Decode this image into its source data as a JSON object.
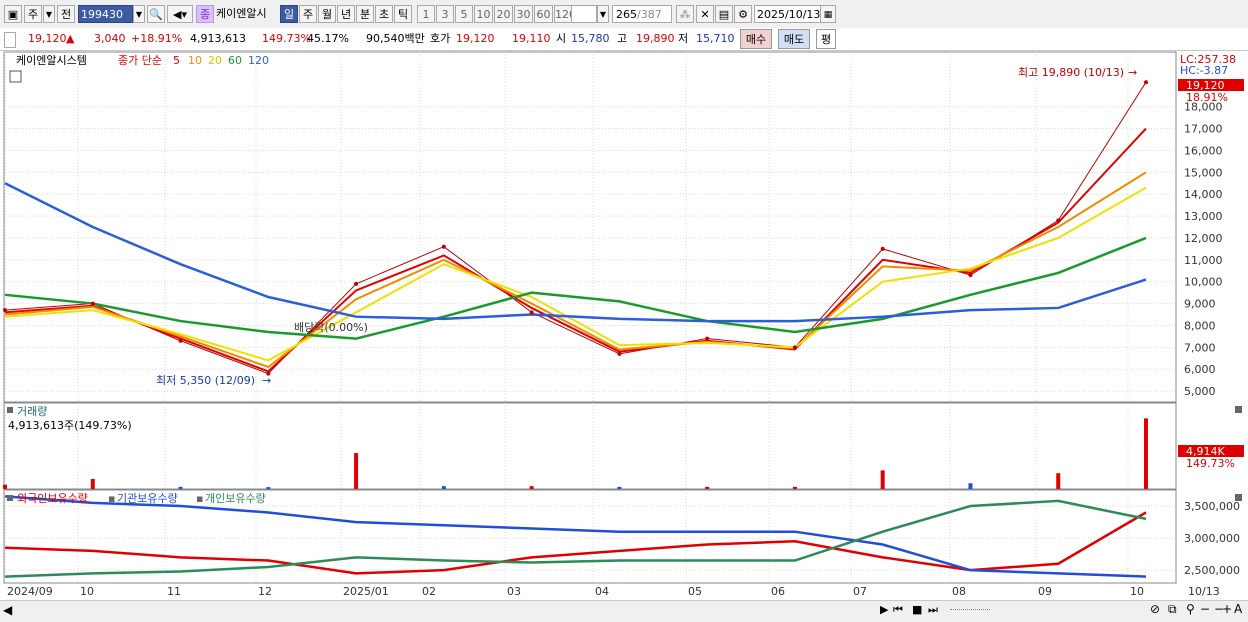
{
  "toolbar": {
    "period": "주",
    "prev": "전",
    "code": "199430",
    "stock_tag": "종",
    "stock_name": "케이엔알시",
    "periods": [
      "일",
      "주",
      "월",
      "년",
      "분",
      "초",
      "틱"
    ],
    "active_period": "일",
    "counts": [
      "1",
      "3",
      "5",
      "10",
      "20",
      "30",
      "60",
      "120"
    ],
    "page_count": "265",
    "page_total": "/387",
    "date": "2025/10/13"
  },
  "quote": {
    "price": "19,120",
    "arrow": "▲",
    "change": "3,040",
    "change_pct": "+18.91%",
    "volume": "4,913,613",
    "vol_ratio": "149.73%",
    "turnover_pct": "45.17%",
    "amount": "90,540백만",
    "bid_label": "호가",
    "bid1": "19,120",
    "bid2": "19,110",
    "open_label": "시",
    "open": "15,780",
    "high_label": "고",
    "high": "19,890",
    "low_label": "저",
    "low": "15,710",
    "buy": "매수",
    "sell": "매도",
    "eval": "평"
  },
  "price_panel": {
    "name": "케이엔알시스템",
    "ma_label": "종가 단순",
    "ma_periods": [
      "5",
      "10",
      "20",
      "60",
      "120"
    ],
    "lc": "LC:257.38",
    "hc": "HC:-3.87",
    "last_price": "19,120",
    "last_pct": "18.91%",
    "high_note": "최고 19,890 (10/13)",
    "low_note": "최저 5,350 (12/09)",
    "dividend_note": "배당락(0.00%)",
    "yticks": [
      "18,000",
      "17,000",
      "16,000",
      "15,000",
      "14,000",
      "13,000",
      "12,000",
      "11,000",
      "10,000",
      "9,000",
      "8,000",
      "7,000",
      "6,000",
      "5,000"
    ]
  },
  "volume_panel": {
    "title": "거래량",
    "value": "4,913,613주(149.73%)",
    "last_label": "4,914K",
    "last_pct": "149.73%"
  },
  "holding_panel": {
    "legend": [
      "외국인보유수량",
      "기관보유수량",
      "개인보유수량"
    ],
    "yticks": [
      "3,500,000",
      "3,000,000",
      "2,500,000"
    ]
  },
  "xaxis": [
    "2024/09",
    "10",
    "11",
    "12",
    "2025/01",
    "02",
    "03",
    "04",
    "05",
    "06",
    "07",
    "08",
    "09",
    "10",
    "10/13"
  ],
  "colors": {
    "up": "#e00000",
    "down": "#1f4fd8",
    "ma5": "#e00000",
    "ma10": "#f08c00",
    "ma20": "#f0e000",
    "ma60": "#1a9a2e",
    "ma120": "#2a5fd8",
    "foreign": "#e00000",
    "inst": "#1f4fd8",
    "indiv": "#2e8b57"
  },
  "chart_data": [
    {
      "type": "line",
      "title": "케이엔알시스템 일봉 (종가 단순 이동평균)",
      "x": [
        "2024/09",
        "10",
        "11",
        "12",
        "2025/01",
        "02",
        "03",
        "04",
        "05",
        "06",
        "07",
        "08",
        "09",
        "10"
      ],
      "series": [
        {
          "name": "close",
          "values": [
            8700,
            9000,
            7300,
            5800,
            9900,
            11600,
            8600,
            6700,
            7400,
            7000,
            11500,
            10300,
            12800,
            19120
          ]
        },
        {
          "name": "5",
          "values": [
            8600,
            8900,
            7400,
            5900,
            9600,
            11200,
            8800,
            6800,
            7300,
            6900,
            11000,
            10400,
            12700,
            17000
          ]
        },
        {
          "name": "10",
          "values": [
            8500,
            8850,
            7500,
            6100,
            9200,
            11000,
            9000,
            6900,
            7250,
            6950,
            10700,
            10500,
            12500,
            15000
          ]
        },
        {
          "name": "20",
          "values": [
            8400,
            8700,
            7600,
            6400,
            8600,
            10800,
            9300,
            7100,
            7200,
            7000,
            10000,
            10600,
            12000,
            14300
          ]
        },
        {
          "name": "60",
          "values": [
            9400,
            9000,
            8200,
            7700,
            7400,
            8400,
            9500,
            9100,
            8200,
            7700,
            8300,
            9400,
            10400,
            12000
          ]
        },
        {
          "name": "120",
          "values": [
            14500,
            12500,
            10800,
            9300,
            8400,
            8300,
            8500,
            8300,
            8200,
            8200,
            8400,
            8700,
            8800,
            10100
          ]
        }
      ],
      "ylim": [
        4500,
        20500
      ]
    },
    {
      "type": "bar",
      "title": "거래량",
      "x": [
        "2024/09",
        "10",
        "11",
        "12",
        "2025/01",
        "02",
        "03",
        "04",
        "05",
        "06",
        "07",
        "08",
        "09",
        "10"
      ],
      "values": [
        300000,
        700000,
        150000,
        130000,
        2500000,
        200000,
        200000,
        150000,
        150000,
        150000,
        1300000,
        400000,
        1100000,
        4913613
      ]
    },
    {
      "type": "line",
      "title": "보유수량",
      "x": [
        "2024/09",
        "10",
        "11",
        "12",
        "2025/01",
        "02",
        "03",
        "04",
        "05",
        "06",
        "07",
        "08",
        "09",
        "10"
      ],
      "series": [
        {
          "name": "외국인보유수량",
          "values": [
            2850000,
            2800000,
            2700000,
            2650000,
            2450000,
            2500000,
            2700000,
            2800000,
            2900000,
            2950000,
            2700000,
            2500000,
            2600000,
            3400000
          ]
        },
        {
          "name": "기관보유수량",
          "values": [
            3650000,
            3550000,
            3500000,
            3400000,
            3250000,
            3200000,
            3150000,
            3100000,
            3100000,
            3100000,
            2900000,
            2500000,
            2450000,
            2400000
          ]
        },
        {
          "name": "개인보유수량",
          "values": [
            2400000,
            2450000,
            2480000,
            2550000,
            2700000,
            2650000,
            2620000,
            2650000,
            2650000,
            2650000,
            3100000,
            3500000,
            3580000,
            3300000
          ]
        }
      ],
      "ylim": [
        2300000,
        3750000
      ]
    }
  ]
}
